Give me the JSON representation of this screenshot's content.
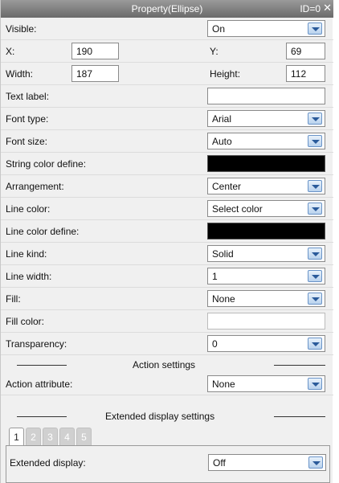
{
  "title_bar": {
    "title": "Property(Ellipse)",
    "id_text": "ID=0",
    "close_glyph": "✕"
  },
  "visible": {
    "label": "Visible:",
    "value": "On"
  },
  "position": {
    "x_label": "X:",
    "x_value": "190",
    "y_label": "Y:",
    "y_value": "69"
  },
  "size": {
    "width_label": "Width:",
    "width_value": "187",
    "height_label": "Height:",
    "height_value": "112"
  },
  "text_label": {
    "label": "Text label:",
    "value": ""
  },
  "font_type": {
    "label": "Font type:",
    "value": "Arial"
  },
  "font_size": {
    "label": "Font size:",
    "value": "Auto"
  },
  "string_color_define": {
    "label": "String color define:",
    "color": "#000000"
  },
  "arrangement": {
    "label": "Arrangement:",
    "value": "Center"
  },
  "line_color": {
    "label": "Line color:",
    "value": "Select color"
  },
  "line_color_define": {
    "label": "Line color define:",
    "color": "#000000"
  },
  "line_kind": {
    "label": "Line kind:",
    "value": "Solid"
  },
  "line_width": {
    "label": "Line width:",
    "value": "1"
  },
  "fill": {
    "label": "Fill:",
    "value": "None"
  },
  "fill_color": {
    "label": "Fill color:",
    "color": "#ffffff"
  },
  "transparency": {
    "label": "Transparency:",
    "value": "0"
  },
  "action_settings": {
    "title": "Action settings"
  },
  "action_attribute": {
    "label": "Action attribute:",
    "value": "None"
  },
  "extended_display_settings": {
    "title": "Extended display settings"
  },
  "tabs": [
    "1",
    "2",
    "3",
    "4",
    "5"
  ],
  "extended_display": {
    "label": "Extended display:",
    "value": "Off"
  },
  "icons": {
    "dropdown": "chevron-down-icon",
    "close": "close-icon"
  }
}
